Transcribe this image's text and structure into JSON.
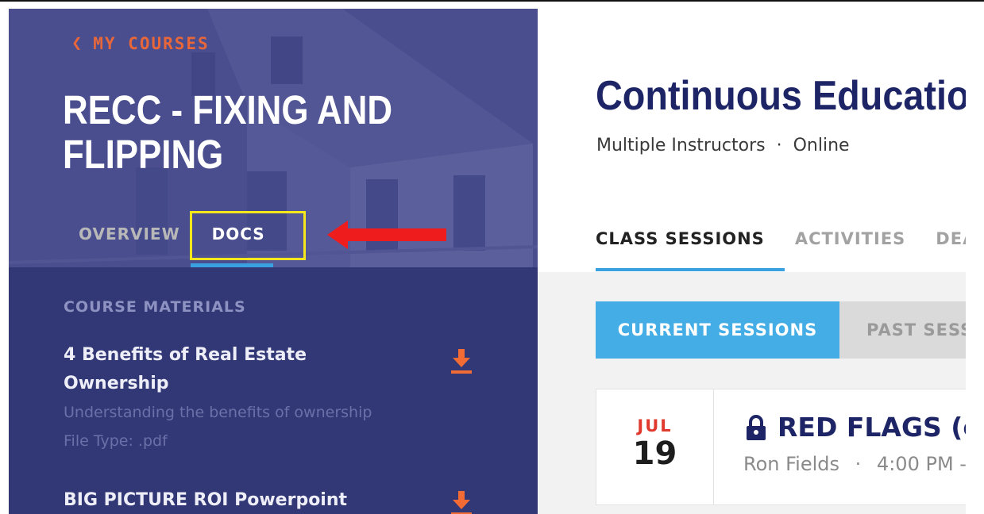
{
  "sidebar": {
    "back_label": "MY COURSES",
    "course_title_line1": "RECC - FIXING AND",
    "course_title_line2": "FLIPPING",
    "tabs": [
      {
        "label": "OVERVIEW"
      },
      {
        "label": "DOCS"
      }
    ],
    "materials_heading": "COURSE MATERIALS",
    "materials": [
      {
        "title": "4 Benefits of Real Estate Ownership",
        "description": "Understanding the benefits of ownership",
        "file_type": "File Type: .pdf"
      },
      {
        "title": "BIG PICTURE ROI Powerpoint"
      }
    ]
  },
  "main": {
    "title": "Continuous Education",
    "instructors": "Multiple Instructors",
    "separator": "·",
    "location": "Online",
    "tabs": [
      {
        "label": "CLASS SESSIONS"
      },
      {
        "label": "ACTIVITIES"
      },
      {
        "label": "DEA"
      }
    ],
    "segments": {
      "current": "CURRENT SESSIONS",
      "past": "PAST SESS"
    },
    "session": {
      "month": "JUL",
      "day": "19",
      "title": "RED FLAGS (co",
      "instructor": "Ron Fields",
      "time": "4:00 PM -"
    }
  },
  "colors": {
    "sidebar_bg": "#323875",
    "accent_blue": "#44ade6",
    "accent_orange": "#e8673a",
    "title_navy": "#1e2566",
    "highlight_yellow": "#f4e81b",
    "arrow_red": "#ee1c1c"
  },
  "icons": {
    "back": "chevron-left-icon",
    "download": "download-icon",
    "lock": "lock-icon",
    "annotation": "arrow-left-icon"
  }
}
